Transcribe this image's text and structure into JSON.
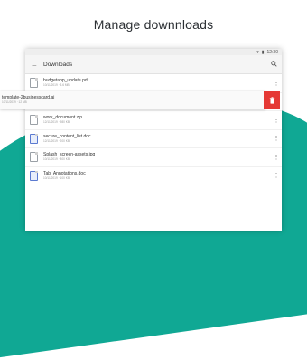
{
  "headline": "Manage downnloads",
  "status_bar": {
    "signal": "▾",
    "battery": "▮",
    "time": "12:30"
  },
  "app_bar": {
    "back_icon": "arrow-left",
    "title": "Downloads",
    "search_icon": "search"
  },
  "files": [
    {
      "name": "budgetapp_update.pdf",
      "meta": "10/11/2019 · 3.6 MB",
      "icon": "file-icon"
    },
    {
      "name": "work_document.zip",
      "meta": "12/11/2019 · 980 KB",
      "icon": "file-icon"
    },
    {
      "name": "secure_content_list.doc",
      "meta": "12/11/2019 · 200 KB",
      "icon": "doc-icon"
    },
    {
      "name": "Splash_screen-assets.jpg",
      "meta": "10/11/2019 · 800 KB",
      "icon": "file-icon"
    },
    {
      "name": "Tab_Annotations.doc",
      "meta": "10/11/2019 · 100 KB",
      "icon": "doc-icon"
    }
  ],
  "swiped_file": {
    "name": "template-2businesscard.ai",
    "meta": "10/11/2019 · 12 MB"
  },
  "delete_icon": "trash-icon",
  "more_icon": "⋮"
}
